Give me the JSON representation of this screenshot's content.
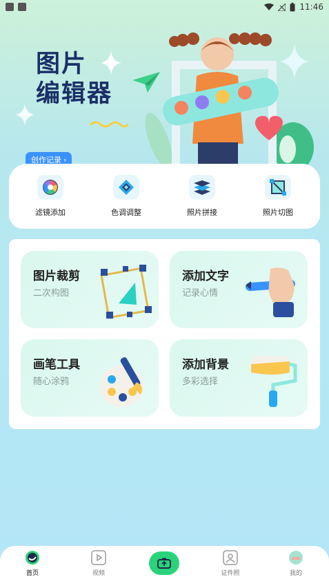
{
  "status_bar": {
    "time": "11:46"
  },
  "hero": {
    "title_line1": "图片",
    "title_line2": "编辑器",
    "creation_button": "创作记录",
    "creation_chevron": "›"
  },
  "tools": [
    {
      "label": "滤镜添加",
      "icon": "color-wheel-icon"
    },
    {
      "label": "色调调整",
      "icon": "diamond-adjust-icon"
    },
    {
      "label": "照片拼接",
      "icon": "layers-icon"
    },
    {
      "label": "照片切图",
      "icon": "crop-frame-icon"
    }
  ],
  "features": [
    {
      "title": "图片裁剪",
      "subtitle": "二次构图",
      "icon": "crop-corners-icon"
    },
    {
      "title": "添加文字",
      "subtitle": "记录心情",
      "icon": "hand-pen-icon"
    },
    {
      "title": "画笔工具",
      "subtitle": "随心涂鸦",
      "icon": "palette-brush-icon"
    },
    {
      "title": "添加背景",
      "subtitle": "多彩选择",
      "icon": "paint-roller-icon"
    }
  ],
  "tabbar": {
    "items": [
      {
        "label": "首页",
        "icon": "home-icon",
        "active": true
      },
      {
        "label": "视频",
        "icon": "video-icon",
        "active": false
      },
      {
        "label": "",
        "icon": "camera-icon",
        "active": false
      },
      {
        "label": "证件照",
        "icon": "id-photo-icon",
        "active": false
      },
      {
        "label": "我的",
        "icon": "profile-icon",
        "active": false
      }
    ]
  },
  "colors": {
    "accent_blue": "#3a92ff",
    "title_navy": "#1a2f67",
    "camera_green": "#2ad37a"
  }
}
